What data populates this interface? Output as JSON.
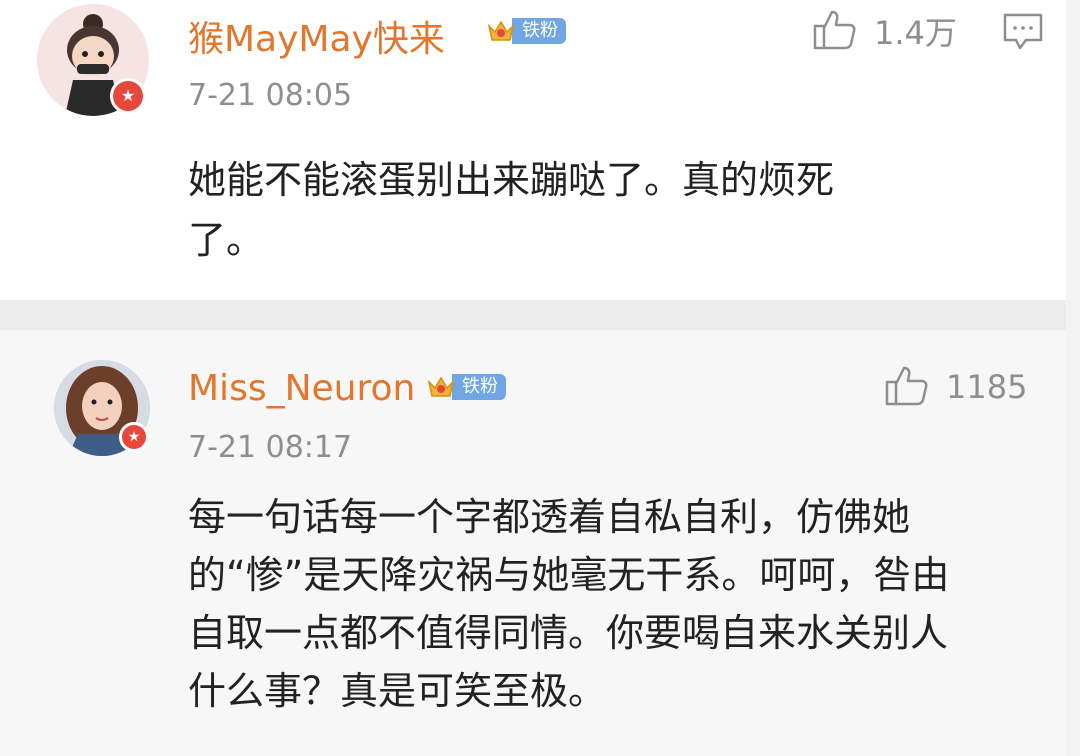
{
  "comments": [
    {
      "username": "猴MayMay快来",
      "fan_badge": "铁粉",
      "timestamp": "7-21 08:05",
      "likes": "1.4万",
      "text_lines": [
        "她能不能滚蛋别出来蹦哒了。真的烦死",
        "了。"
      ],
      "icons": [
        "avatar",
        "verified-star-icon",
        "crown-icon",
        "thumbs-up-icon",
        "reply-icon"
      ]
    },
    {
      "username": "Miss_Neuron",
      "fan_badge": "铁粉",
      "timestamp": "7-21 08:17",
      "likes": "1185",
      "text_lines": [
        "每一句话每一个字都透着自私自利，仿佛她",
        "的“惨”是天降灾祸与她毫无干系。呵呵，咎由",
        "自取一点都不值得同情。你要喝自来水关别人",
        "什么事？真是可笑至极。"
      ],
      "icons": [
        "avatar",
        "verified-star-icon",
        "crown-icon",
        "thumbs-up-icon"
      ]
    }
  ],
  "colors": {
    "username": "#e3762c",
    "fan_badge": "#6fa6e3",
    "verified_badge": "#e8483b",
    "meta_text": "#8e8e8e"
  }
}
